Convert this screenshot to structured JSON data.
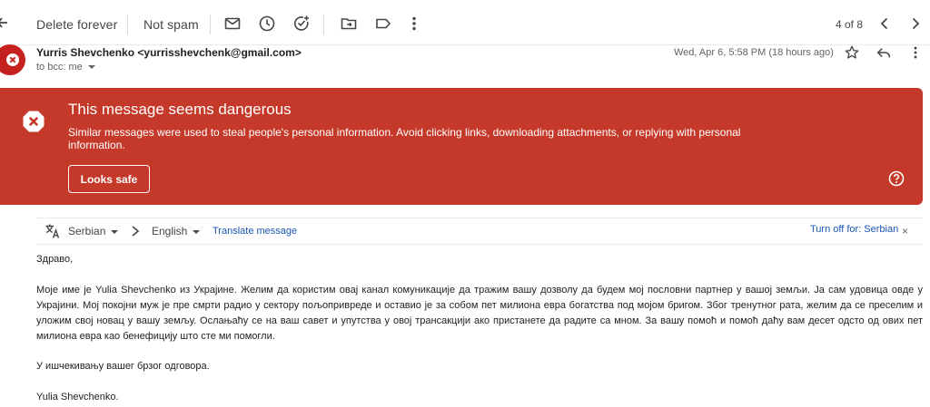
{
  "toolbar": {
    "delete_forever": "Delete forever",
    "not_spam": "Not spam",
    "pager": "4 of 8"
  },
  "message": {
    "sender": "Yurris Shevchenko <yurrisshevchenk@gmail.com>",
    "recipient": "to bcc: me",
    "date": "Wed, Apr 6, 5:58 PM (18 hours ago)"
  },
  "warning": {
    "title": "This message seems dangerous",
    "body": "Similar messages were used to steal people's personal information. Avoid clicking links, downloading attachments, or replying with personal information.",
    "button": "Looks safe",
    "color": "#c5392b"
  },
  "translate": {
    "source_lang": "Serbian",
    "target_lang": "English",
    "translate_link": "Translate message",
    "turn_off": "Turn off for: Serbian",
    "close": "×"
  },
  "body": {
    "greeting": "Здраво,",
    "paragraph": "Моје име је Yulia Shevchenko из Украјине. Желим да користим овај канал комуникације да тражим вашу дозволу да будем мој пословни партнер у вашој земљи. Ја сам удовица овде у Украјини. Мој покојни муж је пре смрти радио у сектору пољопривреде и оставио је за собом пет милиона евра богатства под мојом бригом. Због тренутног рата, желим да се преселим и уложим свој новац у вашу земљу. Ослањаћу се на ваш савет и упутства у овој трансакцији ако пристанете да радите са мном. За вашу помоћ и помоћ даћу вам десет одсто од ових пет милиона евра као бенефицију што сте ми помогли.",
    "closing": "У ишчекивању вашег брзог одговора.",
    "signature": "Yulia Shevchenko."
  },
  "icons": {
    "back": "arrow-left-icon",
    "mark_unread": "envelope-icon",
    "snooze": "clock-icon",
    "add_task": "add-task-icon",
    "move_to": "move-to-folder-icon",
    "label": "label-icon",
    "more": "more-vert-icon",
    "older": "chevron-left-icon",
    "newer": "chevron-right-icon",
    "star": "star-icon",
    "reply": "reply-icon",
    "warning": "danger-x-icon",
    "help": "help-icon",
    "translate": "translate-icon"
  }
}
